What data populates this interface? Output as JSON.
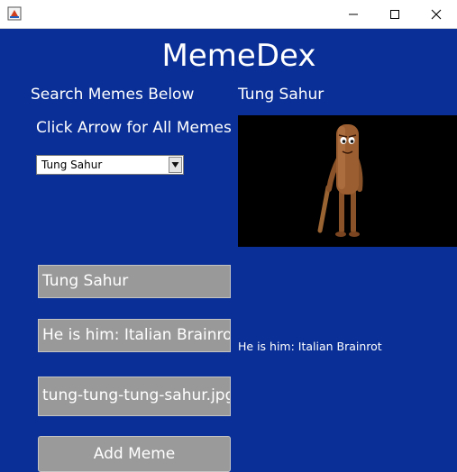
{
  "window": {
    "title": "",
    "controls": {
      "minimize": "minimize-icon",
      "maximize": "maximize-icon",
      "close": "close-icon"
    }
  },
  "app": {
    "title": "MemeDex",
    "search_label": "Search Memes Below",
    "arrow_hint": "Click Arrow for All Memes",
    "selected_meme": "Tung Sahur",
    "meme_name_label": "Tung Sahur",
    "description_label": "He is him: Italian Brainrot"
  },
  "form": {
    "name_value": "Tung Sahur",
    "description_value": "He is him: Italian Brainrot",
    "filename_value": "tung-tung-tung-sahur.jpg",
    "add_button_label": "Add Meme"
  },
  "colors": {
    "background": "#0a2f96",
    "field": "#999999",
    "text": "#ffffff"
  }
}
